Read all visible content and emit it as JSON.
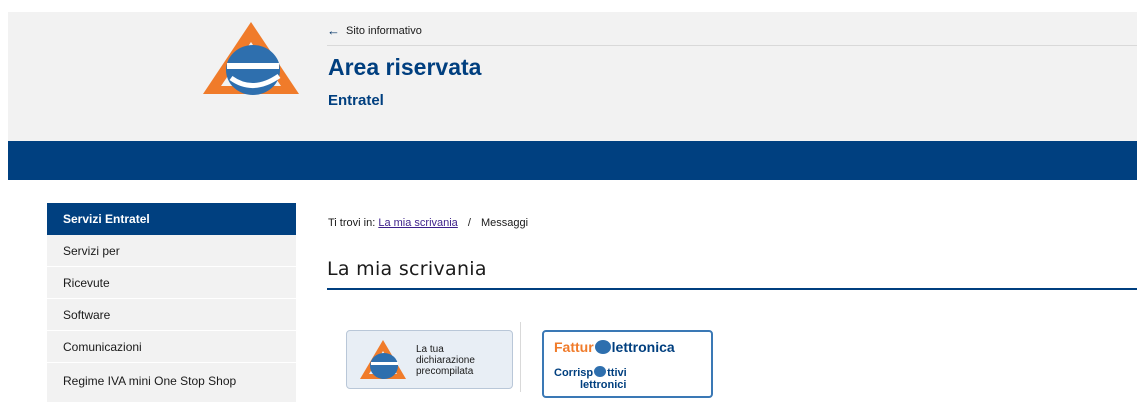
{
  "header": {
    "back_link": "Sito informativo",
    "title": "Area riservata",
    "subtitle": "Entratel"
  },
  "sidebar": {
    "head": "Servizi Entratel",
    "items": [
      {
        "label": "Servizi per"
      },
      {
        "label": "Ricevute"
      },
      {
        "label": "Software"
      },
      {
        "label": "Comunicazioni"
      },
      {
        "label": "Regime IVA mini One Stop Shop"
      }
    ]
  },
  "breadcrumb": {
    "prefix": "Ti trovi in:",
    "link": "La mia scrivania",
    "separator": "/",
    "current": "Messaggi"
  },
  "main": {
    "title": "La mia scrivania"
  },
  "cards": {
    "precompilata": {
      "line1": "La tua",
      "line2": "dichiarazione",
      "line3": "precompilata"
    },
    "fatture": {
      "fatture_prefix": "Fattur",
      "fatture_suffix": "lettronica",
      "corrisp_prefix": "Corrisp",
      "corrisp_suffix": "ttivi",
      "corrisp_line2": "lettronici"
    }
  },
  "colors": {
    "primary": "#004080",
    "accent": "#f07b2a",
    "header_bg": "#f2f2f2"
  }
}
